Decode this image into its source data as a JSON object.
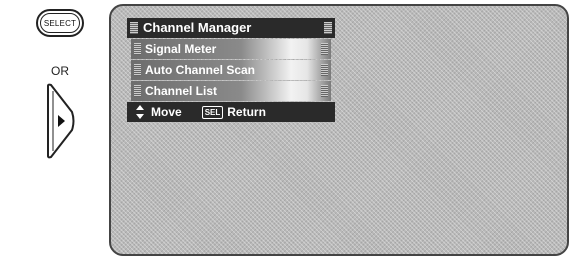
{
  "remote": {
    "select_label": "SELECT",
    "or_text": "OR",
    "arrow_icon": "right-arrow-icon"
  },
  "menu": {
    "title": "Channel Manager",
    "items": [
      {
        "label": "Signal Meter"
      },
      {
        "label": "Auto Channel Scan"
      },
      {
        "label": "Channel List"
      }
    ],
    "footer": {
      "move_label": "Move",
      "sel_icon_text": "SEL",
      "return_label": "Return"
    }
  }
}
